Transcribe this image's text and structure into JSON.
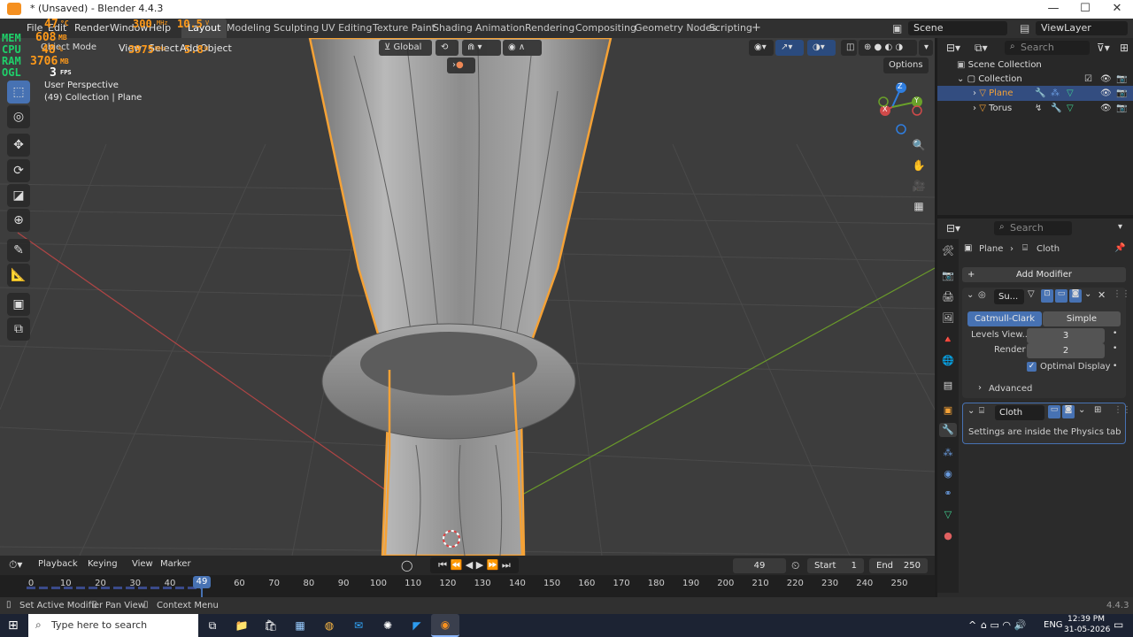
{
  "window": {
    "title": "* (Unsaved) - Blender 4.4.3",
    "minimize": "—",
    "maximize": "☐",
    "close": "✕"
  },
  "overlay": {
    "fps_value": "300",
    "fps_unit": "MHz",
    "voltage": "10.5",
    "voltage_unit": "V",
    "cpu_temp": "47",
    "cpu_temp_unit": "°C",
    "mem": "608",
    "mem_unit": "MB",
    "cpu_load": "48",
    "cpu_load_unit": "%",
    "ram": "3706",
    "ram_unit": "MB",
    "gpu_clock": "3975",
    "gpu_clock_unit": "MHz",
    "gpu_volt": "5.8",
    "gpu_volt_unit": "W",
    "ogl_fps": "3",
    "ogl_unit": "FPS",
    "labels": {
      "mem": "MEM",
      "cpu": "CPU",
      "ram": "RAM",
      "ogl": "OGL"
    }
  },
  "menubar": {
    "menus": [
      "File",
      "Edit",
      "Render",
      "Window",
      "Help"
    ],
    "workspaces": [
      "Layout",
      "Modeling",
      "Sculpting",
      "UV Editing",
      "Texture Paint",
      "Shading",
      "Animation",
      "Rendering",
      "Compositing",
      "Geometry Nodes",
      "Scripting"
    ],
    "active_workspace": "Layout",
    "add_tab": "+",
    "scene": "Scene",
    "view_layer": "ViewLayer"
  },
  "viewport": {
    "mode": "Object Mode",
    "header_menus": [
      "View",
      "Select",
      "Add",
      "Object"
    ],
    "transform_orientation": "Global",
    "options": "Options",
    "info_line1": "User Perspective",
    "info_line2": "(49) Collection | Plane",
    "gizmo": {
      "x": "X",
      "y": "Y",
      "z": "Z"
    }
  },
  "outliner": {
    "search_placeholder": "Search",
    "items": [
      {
        "label": "Scene Collection"
      },
      {
        "label": "Collection"
      },
      {
        "label": "Plane",
        "selected": true
      },
      {
        "label": "Torus"
      }
    ]
  },
  "properties": {
    "search_placeholder": "Search",
    "breadcrumb_object": "Plane",
    "breadcrumb_modifier": "Cloth",
    "add_modifier": "Add Modifier",
    "subsurf": {
      "name": "Su...",
      "catmull_clark": "Catmull-Clark",
      "simple": "Simple",
      "levels_viewport_label": "Levels View...",
      "levels_viewport_value": "3",
      "render_label": "Render",
      "render_value": "2",
      "optimal_display_label": "Optimal Display",
      "optimal_display_checked": true,
      "advanced": "Advanced"
    },
    "cloth": {
      "name": "Cloth",
      "message": "Settings are inside the Physics tab"
    }
  },
  "timeline": {
    "menus": [
      "Playback",
      "Keying",
      "View",
      "Marker"
    ],
    "current_frame": "49",
    "start_label": "Start",
    "start_value": "1",
    "end_label": "End",
    "end_value": "250",
    "ticks": [
      "0",
      "10",
      "20",
      "30",
      "40",
      "49",
      "60",
      "70",
      "80",
      "90",
      "100",
      "110",
      "120",
      "130",
      "140",
      "150",
      "160",
      "170",
      "180",
      "190",
      "200",
      "210",
      "220",
      "230",
      "240",
      "250"
    ]
  },
  "statusbar": {
    "hint1": "Set Active Modifier",
    "hint2": "Pan View",
    "hint3": "Context Menu",
    "version": "4.4.3"
  },
  "taskbar": {
    "search_placeholder": "Type here to search",
    "language": "ENG",
    "time": "12:39 PM",
    "date": "31-05-2026",
    "tray_chevron": "^"
  },
  "colors": {
    "accent": "#4772b3",
    "selection_orange": "#f5a236",
    "x_axis": "#d04a4a",
    "y_axis": "#6aa12a",
    "z_axis": "#2f7ee0"
  }
}
